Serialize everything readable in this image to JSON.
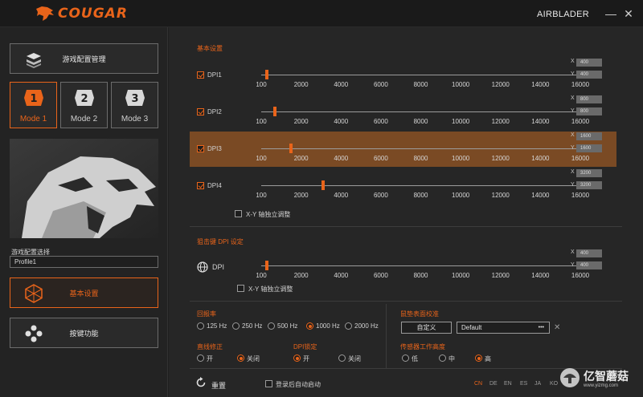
{
  "titlebar": {
    "logo_text": "COUGAR",
    "product": "AIRBLADER",
    "minimize": "—",
    "close": "✕"
  },
  "left": {
    "profile_mgmt_label": "游戏配置管理",
    "modes": [
      {
        "num": "1",
        "label": "Mode 1",
        "active": true
      },
      {
        "num": "2",
        "label": "Mode 2",
        "active": false
      },
      {
        "num": "3",
        "label": "Mode 3",
        "active": false
      }
    ],
    "profile_select_label": "游戏配置选择",
    "profile_value": "Profile1",
    "basic_settings_label": "基本设置",
    "key_function_label": "按键功能"
  },
  "basic": {
    "title": "基本设置",
    "axis_ticks": [
      "100",
      "2000",
      "4000",
      "6000",
      "8000",
      "10000",
      "12000",
      "14000",
      "16000"
    ],
    "axis_min": 100,
    "axis_max": 16000,
    "rows": [
      {
        "label": "DPI1",
        "checked": true,
        "x": "400",
        "y": "400",
        "value": 400,
        "selected": false
      },
      {
        "label": "DPI2",
        "checked": true,
        "x": "800",
        "y": "800",
        "value": 800,
        "selected": false
      },
      {
        "label": "DPI3",
        "checked": true,
        "x": "1600",
        "y": "1600",
        "value": 1600,
        "selected": true
      },
      {
        "label": "DPI4",
        "checked": true,
        "x": "3200",
        "y": "3200",
        "value": 3200,
        "selected": false
      }
    ],
    "x_label": "X",
    "y_label": "Y",
    "xy_independent": "X-Y 轴独立调整"
  },
  "sniper": {
    "title": "狙击键 DPI 设定",
    "label": "DPI",
    "x": "400",
    "y": "400",
    "value": 400,
    "xy_independent": "X-Y 轴独立调整"
  },
  "polling": {
    "title": "回报率",
    "options": [
      "125 Hz",
      "250 Hz",
      "500 Hz",
      "1000 Hz",
      "2000 Hz"
    ],
    "selected": "1000 Hz"
  },
  "surface": {
    "title": "鼠垫表面校准",
    "custom_label": "自定义",
    "default_value": "Default",
    "more": "•••",
    "clear": "✕"
  },
  "angle_snap": {
    "title": "直线修正",
    "options": [
      "开",
      "关闭"
    ],
    "selected": "关闭"
  },
  "dpi_lock": {
    "title": "DPI锁定",
    "options": [
      "开",
      "关闭"
    ],
    "selected": "开"
  },
  "lod": {
    "title": "传感器工作高度",
    "options": [
      "低",
      "中",
      "高"
    ],
    "selected": "高"
  },
  "footer": {
    "reset_label": "重置",
    "autostart_label": "登录后自动启动",
    "languages": [
      "CN",
      "DE",
      "EN",
      "ES",
      "JA",
      "KO"
    ],
    "active_language": "CN",
    "watermark": "亿智蘑菇",
    "watermark_url": "www.yizmg.com"
  },
  "colors": {
    "accent": "#e9641a",
    "selected_row": "#7a4a24",
    "background": "#262626"
  }
}
